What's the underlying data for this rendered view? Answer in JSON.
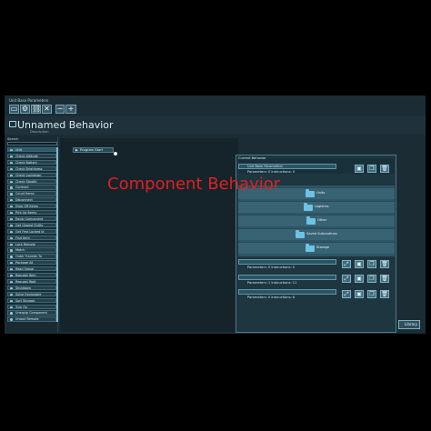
{
  "window": {
    "toolbar_title": "Unit Base Parameters"
  },
  "toolbar": {
    "buttons": [
      {
        "label": "▭",
        "icon": "window-icon"
      },
      {
        "label": "⚙",
        "icon": "gear-icon"
      },
      {
        "label": "⛓",
        "icon": "chain-link-icon"
      },
      {
        "label": "✕",
        "icon": "close-icon"
      },
      {
        "label": "−",
        "icon": "minus-icon"
      },
      {
        "label": "+",
        "icon": "plus-icon"
      }
    ]
  },
  "behavior": {
    "title": "Unnamed Behavior",
    "description": "Description"
  },
  "palette": {
    "search_label": "Search",
    "items": [
      "Unit",
      "Check Altitude",
      "Check Battery",
      "Check Brightness",
      "Check Lockdown",
      "Check Stealth",
      "Contract",
      "Count Items",
      "Disconnect",
      "Drop Off Items",
      "Pick Up Items",
      "Equip Component",
      "Get Closest Entity",
      "Get First Locked Id",
      "Find Item",
      "Lock Remote",
      "Match",
      "Order Transfer To",
      "Package All",
      "Read Signal",
      "Request Item",
      "Request Wait",
      "Shutdown",
      "Solve Explorable",
      "Sort Storage",
      "Turn On",
      "Unequip Component",
      "Unlock Remote"
    ]
  },
  "canvas": {
    "start_node": "Program Start"
  },
  "panel": {
    "title": "Current Behavior",
    "header_row": {
      "name": "Unit Base Parameters",
      "params": "Parameters: 0   Instructions: 0"
    },
    "folders": [
      "Units",
      "Logistics",
      "Other",
      "Saved Subroutines",
      "Storage"
    ],
    "rows": [
      {
        "params": "Parameters: 0   Instructions: 5"
      },
      {
        "params": "Parameters: 1   Instructions: 11"
      },
      {
        "params": "Parameters: 0   Instructions: 8"
      }
    ]
  },
  "library": {
    "label": "Library"
  },
  "overlay_text": "Component Behavior",
  "colors": {
    "accent": "#6ec2e6",
    "overlay": "#e02020",
    "background": "#1b2c34"
  }
}
